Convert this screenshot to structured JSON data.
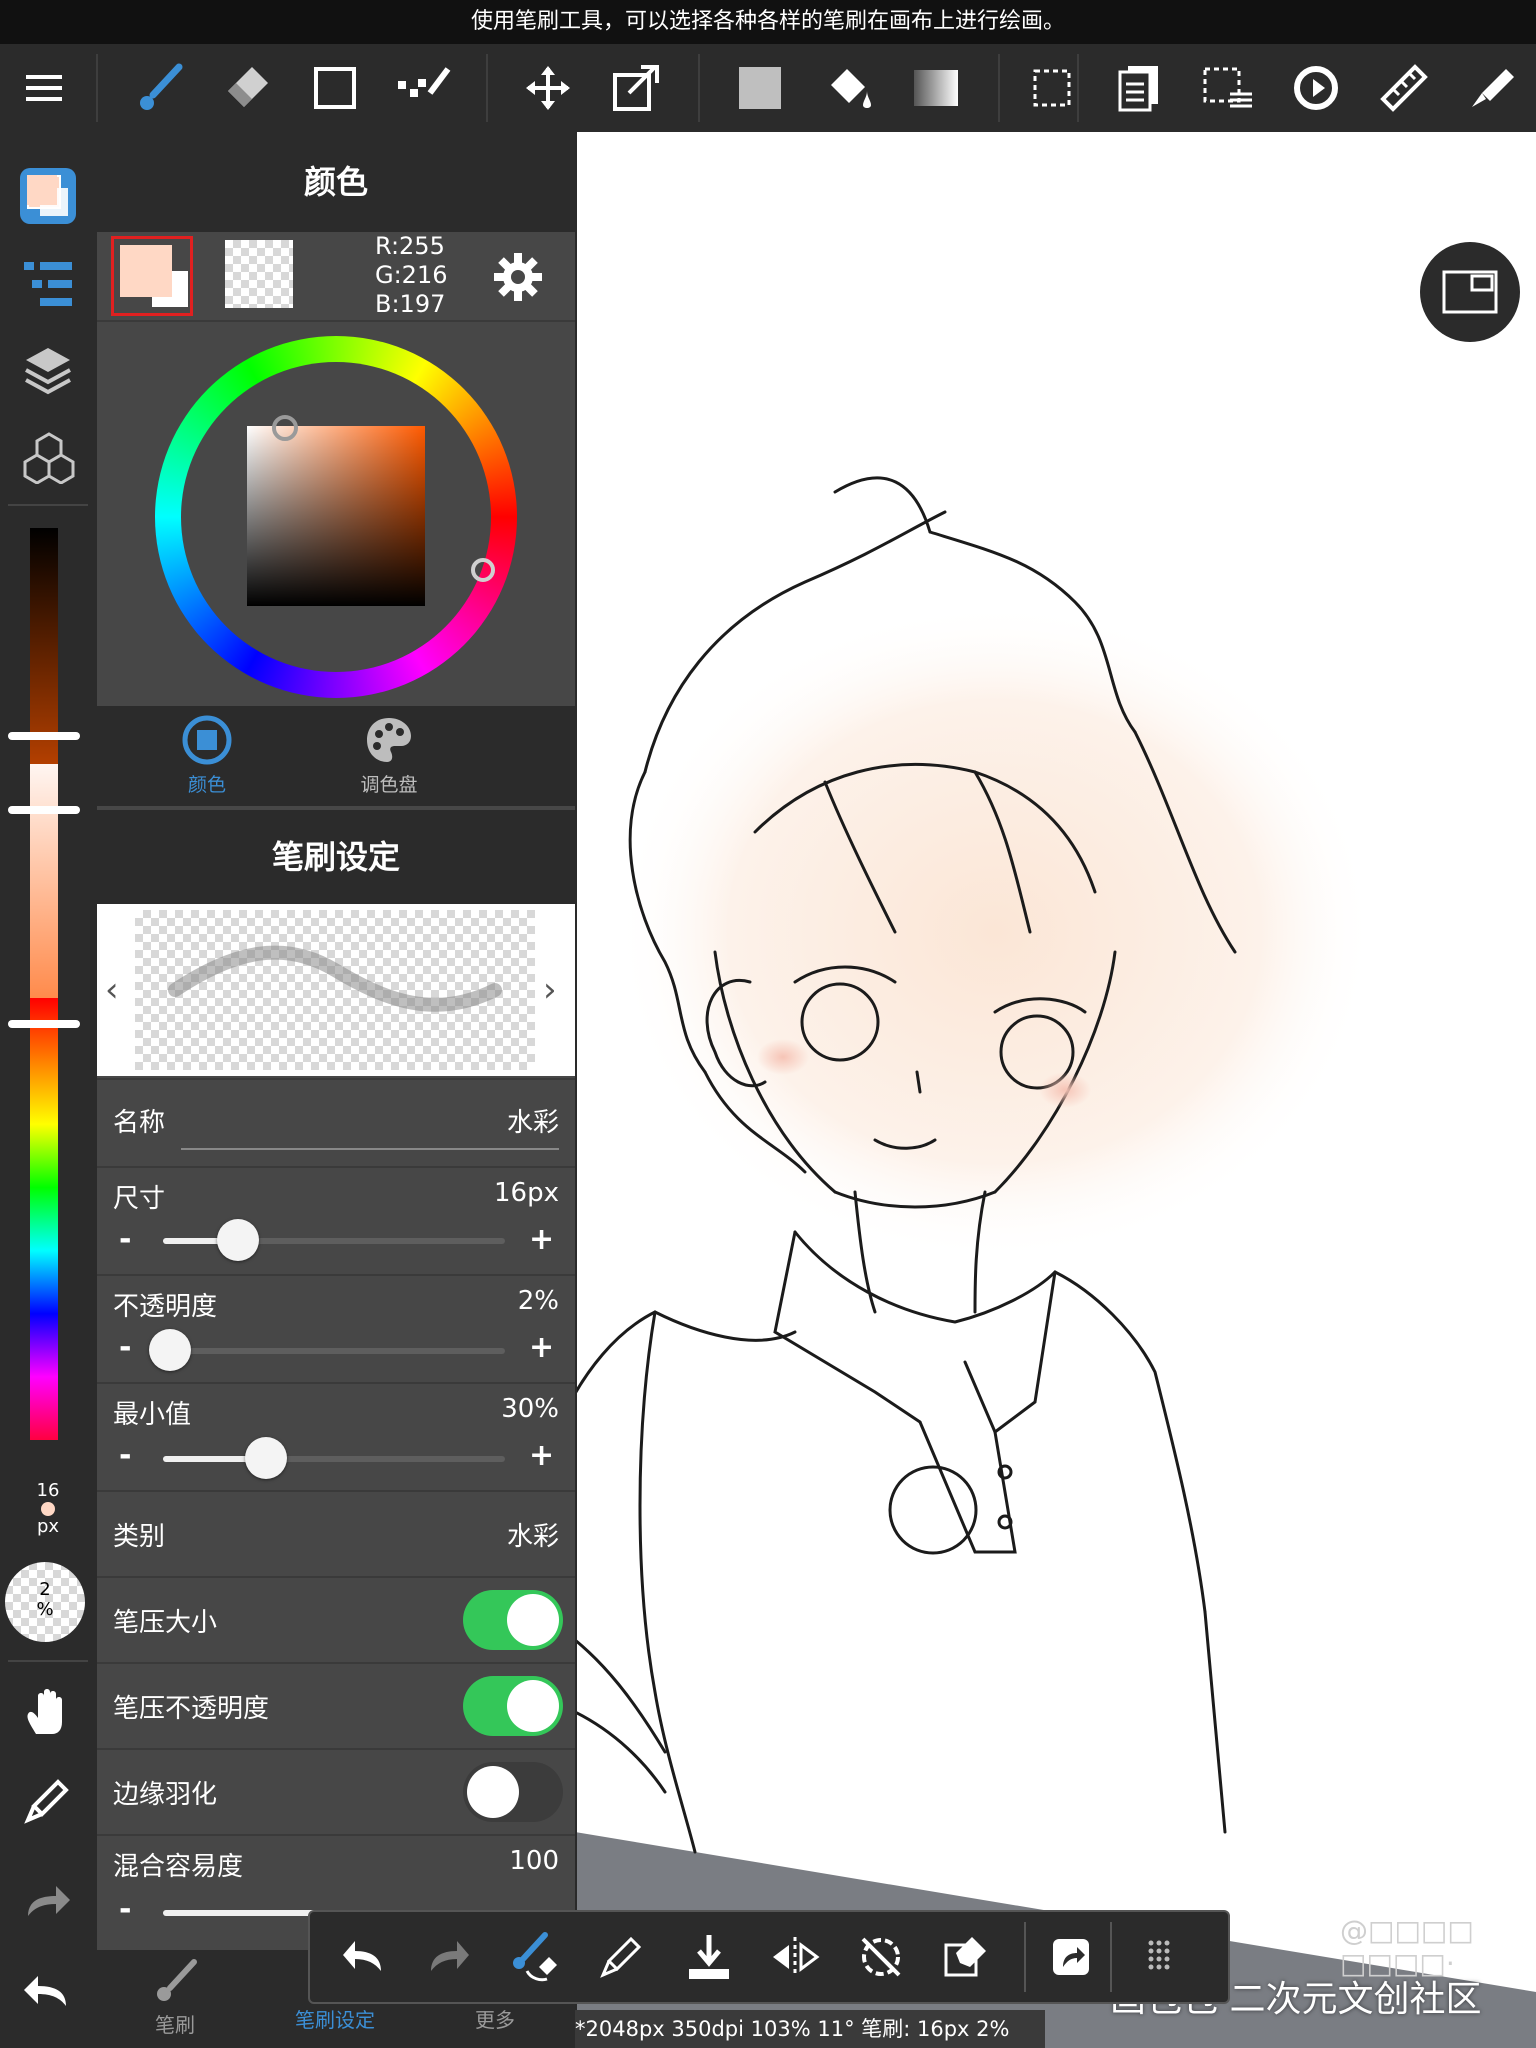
{
  "hint_text": "使用笔刷工具，可以选择各种各样的笔刷在画布上进行绘画。",
  "toolbar": {
    "tools": [
      "menu-icon",
      "brush-icon",
      "eraser-icon",
      "shape-icon",
      "dot-brush-icon",
      "move-icon",
      "transform-icon",
      "fill-color-icon",
      "bucket-icon",
      "gradient-icon",
      "select-rect-icon",
      "layer-copy-icon",
      "select-menu-icon",
      "rotate-icon",
      "ruler-icon",
      "eyedropper-tool-icon"
    ]
  },
  "rail": {
    "brush_size_value": "16",
    "brush_size_unit": "px",
    "opacity_value": "2",
    "opacity_unit": "%"
  },
  "color_panel": {
    "title": "颜色",
    "rgb_r": "R:255",
    "rgb_g": "G:216",
    "rgb_b": "B:197",
    "foreground_color": "#ffd8c5",
    "tab_color": "颜色",
    "tab_palette": "调色盘"
  },
  "brush_panel": {
    "title": "笔刷设定",
    "name_label": "名称",
    "name_value": "水彩",
    "size_label": "尺寸",
    "size_value": "16px",
    "size_fraction": 0.22,
    "opacity_label": "不透明度",
    "opacity_value": "2%",
    "opacity_fraction": 0.02,
    "min_label": "最小值",
    "min_value": "30%",
    "min_fraction": 0.3,
    "category_label": "类别",
    "category_value": "水彩",
    "pressure_size_label": "笔压大小",
    "pressure_size_on": true,
    "pressure_opacity_label": "笔压不透明度",
    "pressure_opacity_on": true,
    "edge_blur_label": "边缘羽化",
    "edge_blur_on": false,
    "blend_label": "混合容易度",
    "blend_value": "100",
    "minus": "-",
    "plus": "+"
  },
  "bottom_tabs": [
    "笔刷",
    "笔刷设定",
    "更多"
  ],
  "status_text": "*2048px 350dpi 103% 11° 笔刷: 16px 2%",
  "watermark_text": "画包包·二次元文创社区",
  "watermark_user": "@□□□□ □□□□·",
  "colors": {
    "accent": "#3b8fd6",
    "toggle_on": "#34c759",
    "panel": "#474747",
    "dark": "#2b2b2b"
  }
}
